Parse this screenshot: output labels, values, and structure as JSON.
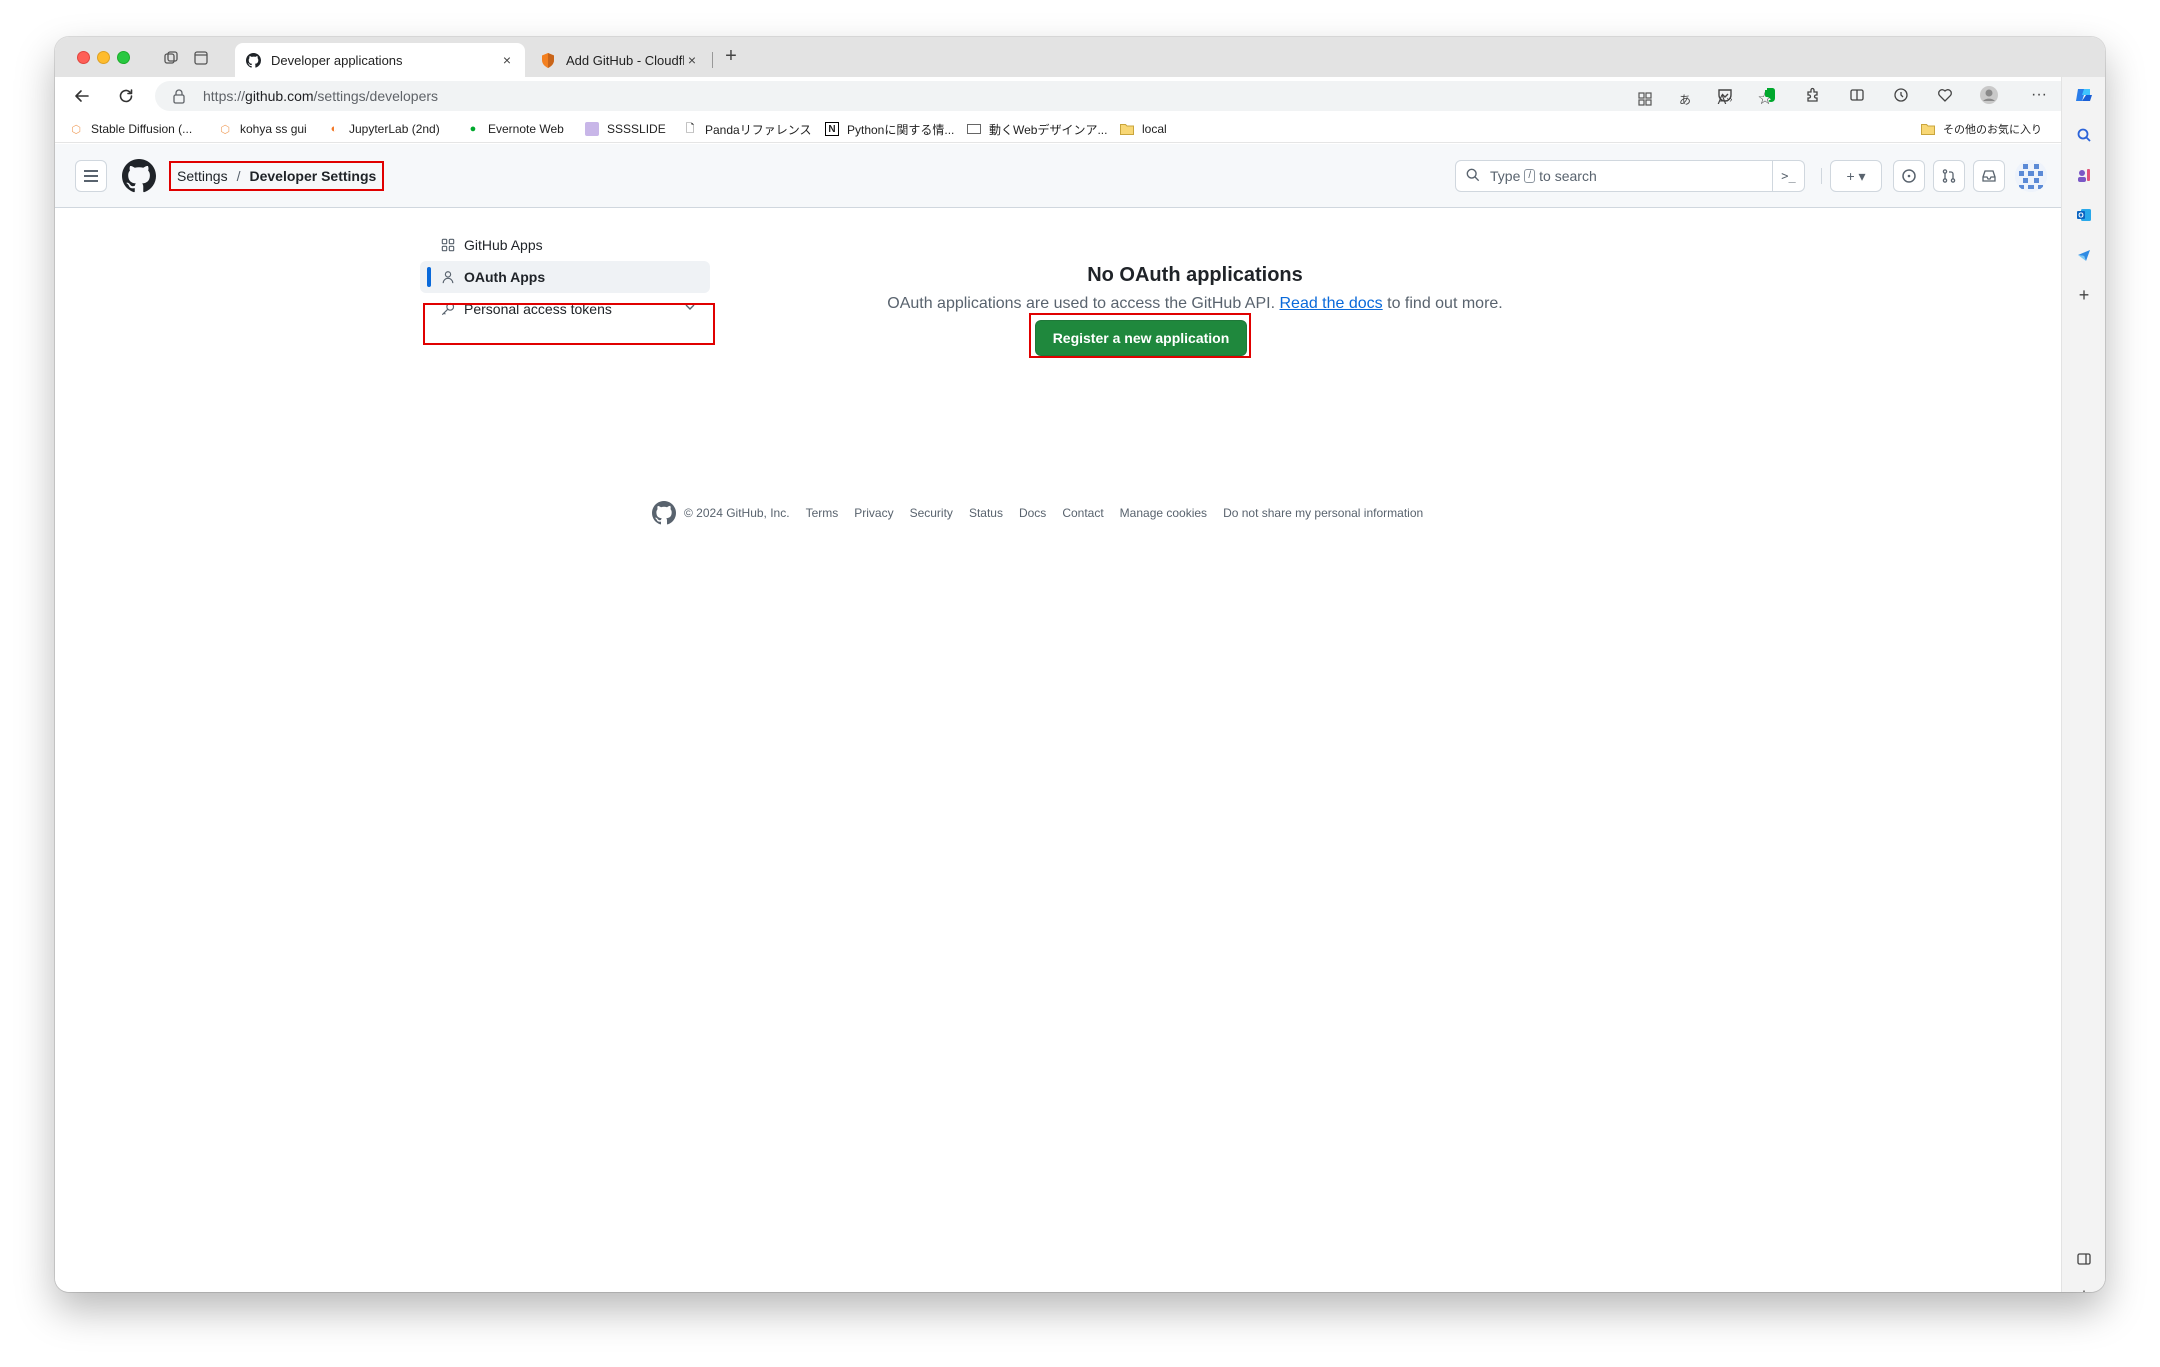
{
  "browser": {
    "tabs": [
      {
        "title": "Developer applications",
        "active": true
      },
      {
        "title": "Add GitHub - Cloudflare One",
        "active": false
      }
    ],
    "close_glyph": "×",
    "newtab_glyph": "+",
    "url": {
      "scheme": "https://",
      "host": "github.com",
      "path": "/settings/developers"
    },
    "bookmarks": [
      "Stable Diffusion (...",
      "kohya ss gui",
      "JupyterLab (2nd)",
      "Evernote Web",
      "SSSSLIDE",
      "Pandaリファレンス",
      "Pythonに関する情...",
      "動くWebデザインア...",
      "local"
    ],
    "other_favorites": "その他のお気に入り"
  },
  "github": {
    "breadcrumb": {
      "parent": "Settings",
      "separator": "/",
      "current": "Developer Settings"
    },
    "search": {
      "prefix": "Type",
      "key": "/",
      "suffix": "to search",
      "cmd_glyph": ">_"
    },
    "create_glyph": "+ ▾",
    "nav": [
      {
        "label": "GitHub Apps",
        "icon": "apps-icon",
        "selected": false
      },
      {
        "label": "OAuth Apps",
        "icon": "person-icon",
        "selected": true
      },
      {
        "label": "Personal access tokens",
        "icon": "key-icon",
        "selected": false,
        "expandable": true
      }
    ],
    "blank": {
      "heading": "No OAuth applications",
      "text_before": "OAuth applications are used to access the GitHub API.",
      "link": "Read the docs",
      "text_after": "to find out more.",
      "button": "Register a new application"
    },
    "footer": {
      "copyright": "© 2024 GitHub, Inc.",
      "links": [
        "Terms",
        "Privacy",
        "Security",
        "Status",
        "Docs",
        "Contact",
        "Manage cookies",
        "Do not share my personal information"
      ]
    }
  },
  "colors": {
    "primary_button": "#1f883d",
    "link": "#0969da",
    "highlight_box": "#e00000",
    "selected_marker": "#0969da"
  }
}
